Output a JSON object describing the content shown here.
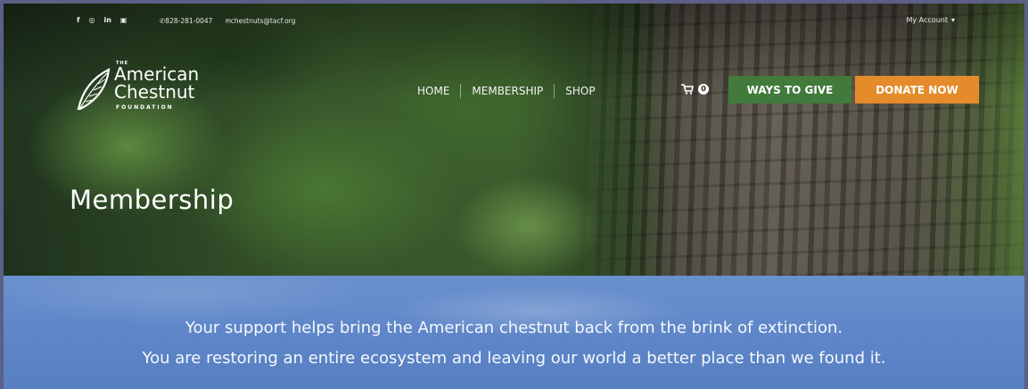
{
  "topbar": {
    "social_icons": [
      "facebook-icon",
      "instagram-icon",
      "linkedin-icon",
      "youtube-icon"
    ],
    "social_glyphs": [
      "f",
      "◎",
      "in",
      "▣"
    ],
    "phone": "828-281-0047",
    "email": "chestnuts@tacf.org",
    "account": "My Account"
  },
  "logo": {
    "the": "THE",
    "line1": "American",
    "line2": "Chestnut",
    "line3": "FOUNDATION"
  },
  "nav": {
    "items": [
      "HOME",
      "MEMBERSHIP",
      "SHOP"
    ],
    "cart_count": "0",
    "ways_to_give": "WAYS TO GIVE",
    "donate": "DONATE NOW"
  },
  "hero": {
    "title": "Membership"
  },
  "band": {
    "line1": "Your support helps bring the American chestnut back from the brink of extinction.",
    "line2": "You are restoring an entire ecosystem and leaving our world a better place than we found it."
  },
  "colors": {
    "ways_button": "#417a3b",
    "donate_button": "#e48b2c",
    "band": "#5e86c8"
  }
}
